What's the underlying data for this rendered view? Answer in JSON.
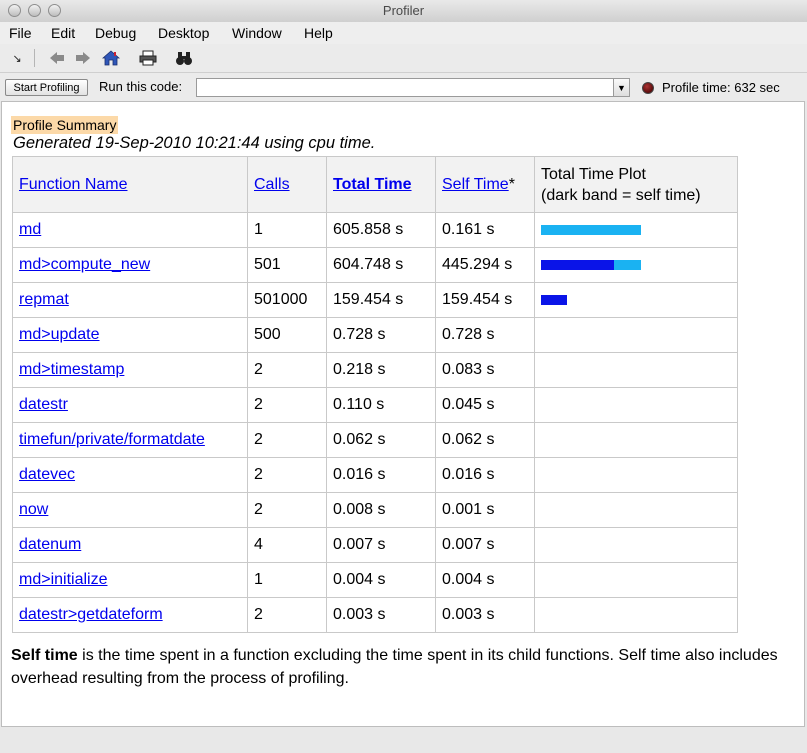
{
  "window": {
    "title": "Profiler"
  },
  "menu": [
    "File",
    "Edit",
    "Debug",
    "Desktop",
    "Window",
    "Help"
  ],
  "toolbar": {
    "icons": [
      "dock-icon",
      "back-arrow-icon",
      "forward-arrow-icon",
      "home-icon",
      "print-icon",
      "find-binoculars-icon"
    ]
  },
  "coderow": {
    "start_label": "Start Profiling",
    "run_label": "Run this code:",
    "input_value": "",
    "profile_time": "Profile time: 632 sec",
    "status_color": "#7a1010"
  },
  "summary": {
    "badge": "Profile Summary",
    "generated": "Generated 19-Sep-2010 10:21:44 using cpu time."
  },
  "table": {
    "headers": {
      "function": "Function Name",
      "calls": "Calls",
      "total": "Total Time",
      "self": "Self Time",
      "self_suffix": "*",
      "plot_line1": "Total Time Plot",
      "plot_line2": "(dark band = self time)"
    },
    "max_total": 605.858,
    "rows": [
      {
        "name": "md",
        "calls": "1",
        "total": "605.858 s",
        "self": "0.161 s",
        "total_val": 605.858,
        "self_val": 0.161
      },
      {
        "name": "md>compute_new",
        "calls": "501",
        "total": "604.748 s",
        "self": "445.294 s",
        "total_val": 604.748,
        "self_val": 445.294
      },
      {
        "name": "repmat",
        "calls": "501000",
        "total": "159.454 s",
        "self": "159.454 s",
        "total_val": 159.454,
        "self_val": 159.454
      },
      {
        "name": "md>update",
        "calls": "500",
        "total": "0.728 s",
        "self": "0.728 s",
        "total_val": 0.728,
        "self_val": 0.728
      },
      {
        "name": "md>timestamp",
        "calls": "2",
        "total": "0.218 s",
        "self": "0.083 s",
        "total_val": 0.218,
        "self_val": 0.083
      },
      {
        "name": "datestr",
        "calls": "2",
        "total": "0.110 s",
        "self": "0.045 s",
        "total_val": 0.11,
        "self_val": 0.045
      },
      {
        "name": "timefun/private/formatdate",
        "calls": "2",
        "total": "0.062 s",
        "self": "0.062 s",
        "total_val": 0.062,
        "self_val": 0.062
      },
      {
        "name": "datevec",
        "calls": "2",
        "total": "0.016 s",
        "self": "0.016 s",
        "total_val": 0.016,
        "self_val": 0.016
      },
      {
        "name": "now",
        "calls": "2",
        "total": "0.008 s",
        "self": "0.001 s",
        "total_val": 0.008,
        "self_val": 0.001
      },
      {
        "name": "datenum",
        "calls": "4",
        "total": "0.007 s",
        "self": "0.007 s",
        "total_val": 0.007,
        "self_val": 0.007
      },
      {
        "name": "md>initialize",
        "calls": "1",
        "total": "0.004 s",
        "self": "0.004 s",
        "total_val": 0.004,
        "self_val": 0.004
      },
      {
        "name": "datestr>getdateform",
        "calls": "2",
        "total": "0.003 s",
        "self": "0.003 s",
        "total_val": 0.003,
        "self_val": 0.003
      }
    ],
    "colors": {
      "total_bar": "#1ab2f2",
      "self_bar": "#0a14e8"
    }
  },
  "footnote": {
    "bold": "Self time",
    "text": " is the time spent in a function excluding the time spent in its child functions. Self time also includes overhead resulting from the process of profiling."
  }
}
